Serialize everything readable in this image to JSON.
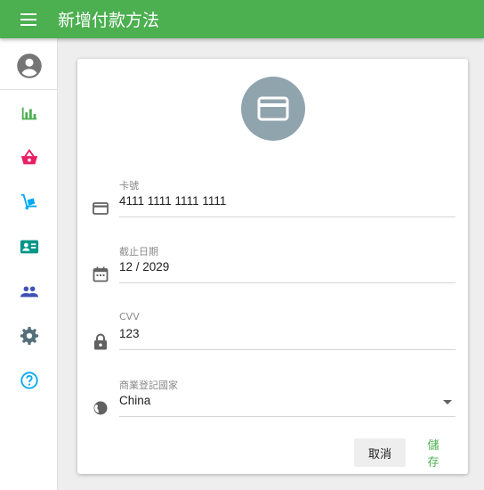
{
  "app": {
    "title": "新增付款方法"
  },
  "sidebar": {
    "avatar_icon": "account-circle-icon",
    "items": [
      {
        "icon": "bar-chart-icon",
        "color": "#4caf50"
      },
      {
        "icon": "shopping-basket-icon",
        "color": "#e91e63"
      },
      {
        "icon": "hand-truck-icon",
        "color": "#03a9f4"
      },
      {
        "icon": "contact-card-icon",
        "color": "#009688"
      },
      {
        "icon": "people-icon",
        "color": "#3f51b5"
      },
      {
        "icon": "settings-icon",
        "color": "#546e7a"
      },
      {
        "icon": "help-icon",
        "color": "#03a9f4"
      }
    ]
  },
  "form": {
    "avatar_icon": "credit-card-icon",
    "card_number": {
      "label": "卡號",
      "value": "4111 1111 1111 1111",
      "icon": "credit-card-icon"
    },
    "expiry": {
      "label": "截止日期",
      "value": "12 / 2029",
      "icon": "calendar-icon"
    },
    "cvv": {
      "label": "CVV",
      "value": "123",
      "icon": "lock-icon"
    },
    "country": {
      "label": "商業登記國家",
      "value": "China",
      "icon": "globe-icon"
    }
  },
  "actions": {
    "cancel_label": "取消",
    "save_label": "儲存"
  },
  "colors": {
    "primary": "#4caf50",
    "avatar_bg": "#90a4ae"
  }
}
